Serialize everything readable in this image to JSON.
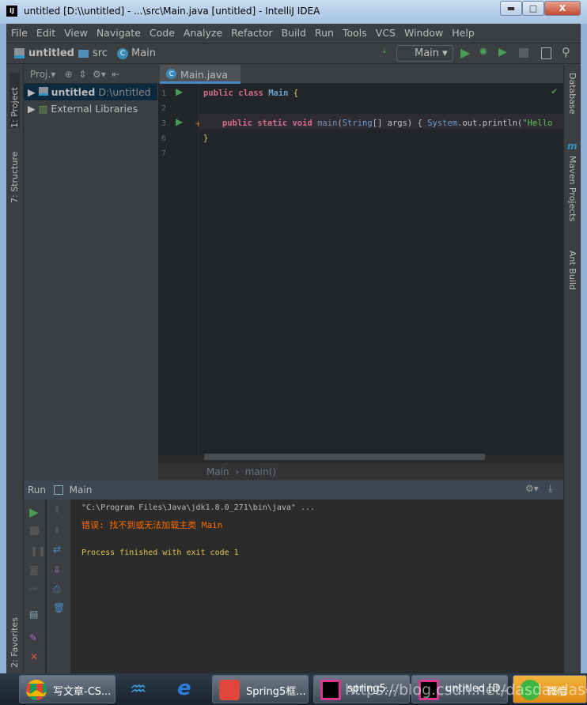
{
  "window": {
    "title": "untitled [D:\\\\untitled] - ...\\src\\Main.java [untitled] - IntelliJ IDEA",
    "logo": "IJ",
    "minimize": "▬",
    "maximize": "□",
    "close": "X"
  },
  "menu": [
    "File",
    "Edit",
    "View",
    "Navigate",
    "Code",
    "Analyze",
    "Refactor",
    "Build",
    "Run",
    "Tools",
    "VCS",
    "Window",
    "Help"
  ],
  "breadcrumb": [
    "untitled",
    "src",
    "Main"
  ],
  "run_config": "Main",
  "left_tools": [
    "1: Project",
    "7: Structure",
    "2: Favorites"
  ],
  "right_tools": [
    "Database",
    "Maven Projects",
    "Ant Build"
  ],
  "project": {
    "header": "Proj.",
    "tree": [
      {
        "name": "untitled",
        "path": "D:\\untitled"
      },
      {
        "name": "External Libraries"
      }
    ]
  },
  "editor": {
    "tab": "Main.java",
    "tab_close": "×",
    "line_numbers": [
      "1",
      "2",
      "3",
      "6",
      "7"
    ],
    "lines": {
      "l1": [
        "public class ",
        "Main",
        " {"
      ],
      "l3": [
        "public static void ",
        "main",
        "(",
        "String",
        "[] args) { ",
        "System",
        ".out.println(",
        "\"Hello"
      ],
      "l6": "}"
    },
    "footer": [
      "Main",
      "›",
      "main()"
    ]
  },
  "run": {
    "label": "Run",
    "config": "Main",
    "output": [
      "\"C:\\Program Files\\Java\\jdk1.8.0_271\\bin\\java\" ...",
      "错误: 找不到或无法加载主类 Main",
      "Process finished with exit code 1"
    ]
  },
  "taskbar": [
    {
      "label": "写文章-CS..."
    },
    {
      "label": "Spring5框..."
    },
    {
      "label": "spring5..."
    },
    {
      "label": "untitled [D..."
    },
    {
      "label": "微信"
    }
  ],
  "watermark": "https://blog.csdn.net/dasdasdasdad",
  "colors": {
    "accent": "#4a88c7",
    "run_green": "#499c54",
    "error": "#ff6b00",
    "console_info": "#e0c34a"
  }
}
